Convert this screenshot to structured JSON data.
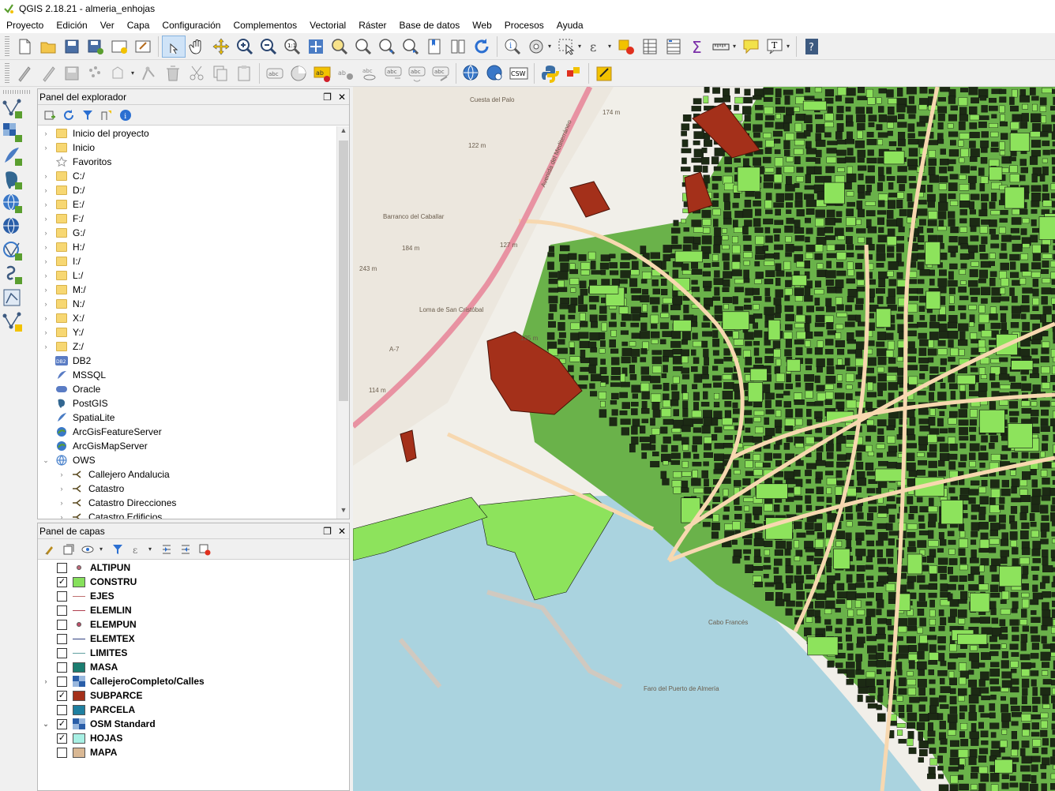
{
  "window": {
    "title": "QGIS 2.18.21 - almeria_enhojas"
  },
  "menu": [
    "Proyecto",
    "Edición",
    "Ver",
    "Capa",
    "Configuración",
    "Complementos",
    "Vectorial",
    "Ráster",
    "Base de datos",
    "Web",
    "Procesos",
    "Ayuda"
  ],
  "toolbar_icons": {
    "row1": [
      "new-project-icon",
      "open-project-icon",
      "save-project-icon",
      "save-as-icon",
      "new-print-composer-icon",
      "composer-manager-icon",
      "pan-touch-icon",
      "pan-icon",
      "pan-to-selection-icon",
      "zoom-in-icon",
      "zoom-out-icon",
      "zoom-native-icon",
      "zoom-full-icon",
      "zoom-selection-icon",
      "zoom-layer-icon",
      "zoom-last-icon",
      "zoom-next-icon",
      "new-bookmark-icon",
      "show-bookmarks-icon",
      "refresh-icon",
      "identify-icon",
      "action-icon",
      "select-icon",
      "select-expression-icon",
      "deselect-icon",
      "attribute-table-icon",
      "field-calculator-icon",
      "statistics-icon",
      "measure-icon",
      "map-tips-icon",
      "annotation-icon",
      "help-icon"
    ],
    "row2": [
      "current-edits-icon",
      "toggle-editing-icon",
      "save-edits-icon",
      "add-feature-icon",
      "move-feature-icon",
      "node-tool-icon",
      "delete-selected-icon",
      "cut-features-icon",
      "copy-features-icon",
      "paste-features-icon",
      "label-icon",
      "diagram-icon",
      "layer-labeling-icon",
      "pin-labels-icon",
      "show-hide-labels-icon",
      "move-label-icon",
      "rotate-label-icon",
      "change-label-icon",
      "wms-search-icon",
      "metasearch-icon",
      "csw-icon",
      "python-console-icon",
      "plugin-icon",
      "georeferencer-icon"
    ]
  },
  "explorer": {
    "title": "Panel del explorador",
    "items": [
      {
        "label": "Inicio del proyecto",
        "icon": "folder-icon",
        "arrow": "›"
      },
      {
        "label": "Inicio",
        "icon": "folder-icon",
        "arrow": "›"
      },
      {
        "label": "Favoritos",
        "icon": "star-icon",
        "arrow": ""
      },
      {
        "label": "C:/",
        "icon": "folder-icon",
        "arrow": "›"
      },
      {
        "label": "D:/",
        "icon": "folder-icon",
        "arrow": "›"
      },
      {
        "label": "E:/",
        "icon": "folder-icon",
        "arrow": "›"
      },
      {
        "label": "F:/",
        "icon": "folder-icon",
        "arrow": "›"
      },
      {
        "label": "G:/",
        "icon": "folder-icon",
        "arrow": "›"
      },
      {
        "label": "H:/",
        "icon": "folder-icon",
        "arrow": "›"
      },
      {
        "label": "I:/",
        "icon": "folder-icon",
        "arrow": "›"
      },
      {
        "label": "L:/",
        "icon": "folder-icon",
        "arrow": "›"
      },
      {
        "label": "M:/",
        "icon": "folder-icon",
        "arrow": "›"
      },
      {
        "label": "N:/",
        "icon": "folder-icon",
        "arrow": "›"
      },
      {
        "label": "X:/",
        "icon": "folder-icon",
        "arrow": "›"
      },
      {
        "label": "Y:/",
        "icon": "folder-icon",
        "arrow": "›"
      },
      {
        "label": "Z:/",
        "icon": "folder-icon",
        "arrow": "›"
      },
      {
        "label": "DB2",
        "icon": "db2-icon",
        "arrow": ""
      },
      {
        "label": "MSSQL",
        "icon": "mssql-icon",
        "arrow": ""
      },
      {
        "label": "Oracle",
        "icon": "oracle-icon",
        "arrow": ""
      },
      {
        "label": "PostGIS",
        "icon": "postgis-icon",
        "arrow": ""
      },
      {
        "label": "SpatiaLite",
        "icon": "spatialite-icon",
        "arrow": ""
      },
      {
        "label": "ArcGisFeatureServer",
        "icon": "arcgis-icon",
        "arrow": ""
      },
      {
        "label": "ArcGisMapServer",
        "icon": "arcgis-icon",
        "arrow": ""
      },
      {
        "label": "OWS",
        "icon": "ows-icon",
        "arrow": "⌄",
        "expanded": true
      },
      {
        "label": "Callejero Andalucia",
        "icon": "wfs-icon",
        "arrow": "›",
        "indent": 1
      },
      {
        "label": "Catastro",
        "icon": "wfs-icon",
        "arrow": "›",
        "indent": 1
      },
      {
        "label": "Catastro Direcciones",
        "icon": "wfs-icon",
        "arrow": "›",
        "indent": 1
      },
      {
        "label": "Catastro Edificios",
        "icon": "wfs-icon",
        "arrow": "›",
        "indent": 1
      }
    ]
  },
  "layers": {
    "title": "Panel de capas",
    "items": [
      {
        "name": "ALTIPUN",
        "checked": false,
        "symbol": "point",
        "color": "#c06a7a"
      },
      {
        "name": "CONSTRU",
        "checked": true,
        "symbol": "fill",
        "color": "#86e05c"
      },
      {
        "name": "EJES",
        "checked": false,
        "symbol": "line",
        "color": "#c07070"
      },
      {
        "name": "ELEMLIN",
        "checked": false,
        "symbol": "line",
        "color": "#b04050"
      },
      {
        "name": "ELEMPUN",
        "checked": false,
        "symbol": "point",
        "color": "#c0506a"
      },
      {
        "name": "ELEMTEX",
        "checked": false,
        "symbol": "line",
        "color": "#304080"
      },
      {
        "name": "LIMITES",
        "checked": false,
        "symbol": "line",
        "color": "#60a0a0"
      },
      {
        "name": "MASA",
        "checked": false,
        "symbol": "fill",
        "color": "#1b7d70"
      },
      {
        "name": "CallejeroCompleto/Calles",
        "checked": false,
        "symbol": "raster",
        "color": "#2a5ea8",
        "arrow": "›"
      },
      {
        "name": "SUBPARCE",
        "checked": true,
        "symbol": "fill",
        "color": "#a4301a"
      },
      {
        "name": "PARCELA",
        "checked": false,
        "symbol": "fill",
        "color": "#1e7fa0"
      },
      {
        "name": "OSM Standard",
        "checked": true,
        "symbol": "raster",
        "color": "#2a5ea8",
        "arrow": "⌄"
      },
      {
        "name": "HOJAS",
        "checked": true,
        "symbol": "fill",
        "color": "#a8f0e4"
      },
      {
        "name": "MAPA",
        "checked": false,
        "symbol": "fill",
        "color": "#d9b894"
      }
    ]
  },
  "map": {
    "colors": {
      "sea": "#aad3df",
      "land": "#f1efe9",
      "buildings": "#8de35c",
      "subparce": "#a4301a",
      "motorway": "#e892a2",
      "road": "#f7d8b0"
    },
    "labels": [
      "Cuesta del Palo",
      "Barranco del Caballar",
      "Loma de San Cristóbal",
      "Avenida del Mediterráneo",
      "Faro del Puerto de Almería",
      "Cabo Francés",
      "A-7",
      "243 m",
      "184 m",
      "127 m",
      "125 m",
      "114 m",
      "122 m",
      "174 m"
    ]
  },
  "help_label": "?"
}
